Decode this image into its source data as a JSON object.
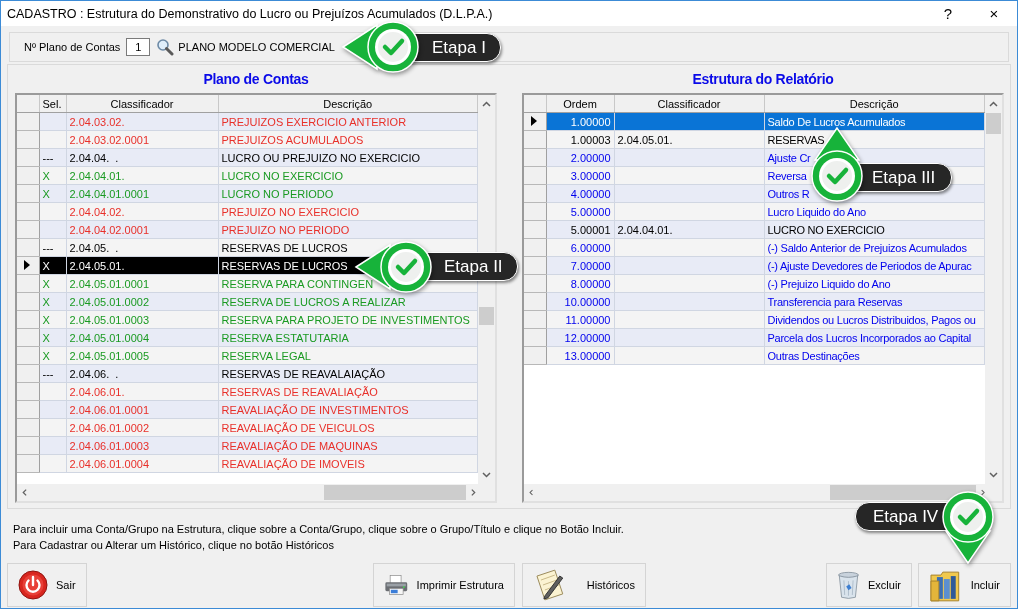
{
  "window": {
    "title": "CADASTRO : Estrutura do Demonstrativo do Lucro ou Prejuízos Acumulados (D.L.P.A.)",
    "controls": [
      "?",
      "×"
    ]
  },
  "plan": {
    "label": "Nº Plano de Contas",
    "number": "1",
    "name": "PLANO MODELO COMERCIAL"
  },
  "left_panel": {
    "title": "Plano de Contas",
    "columns": [
      "Sel.",
      "Classificador",
      "Descrição"
    ],
    "rows": [
      {
        "classificador": "2.04.03.02.",
        "descricao": "PREJUIZOS EXERCICIO ANTERIOR",
        "color": "#e8302a",
        "selected": false
      },
      {
        "classificador": "2.04.03.02.0001",
        "descricao": "PREJUIZOS ACUMULADOS",
        "color": "#e8302a",
        "selected": false
      },
      {
        "sel": "---",
        "classificador": "2.04.04.  .",
        "descricao": "LUCRO OU PREJUIZO NO EXERCICIO",
        "color": "#000000",
        "selected": false
      },
      {
        "sel": "X",
        "classificador": "2.04.04.01.",
        "descricao": "LUCRO NO EXERCICIO",
        "color": "#1a9a22",
        "selected": false
      },
      {
        "sel": "X",
        "classificador": "2.04.04.01.0001",
        "descricao": "LUCRO NO PERIODO",
        "color": "#1a9a22",
        "selected": false
      },
      {
        "classificador": "2.04.04.02.",
        "descricao": "PREJUIZO NO EXERCICIO",
        "color": "#e8302a",
        "selected": false
      },
      {
        "classificador": "2.04.04.02.0001",
        "descricao": "PREJUIZO NO PERIODO",
        "color": "#e8302a",
        "selected": false
      },
      {
        "sel": "---",
        "classificador": "2.04.05.  .",
        "descricao": "RESERVAS DE LUCROS",
        "color": "#000000",
        "selected": false
      },
      {
        "sel": "X",
        "classificador": "2.04.05.01.",
        "descricao": "RESERVAS DE LUCROS",
        "selected": true
      },
      {
        "sel": "X",
        "classificador": "2.04.05.01.0001",
        "descricao": "RESERVA PARA CONTINGEN",
        "color": "#1a9a22",
        "selected": false
      },
      {
        "sel": "X",
        "classificador": "2.04.05.01.0002",
        "descricao": "RESERVA DE LUCROS A REALIZAR",
        "color": "#1a9a22",
        "selected": false
      },
      {
        "sel": "X",
        "classificador": "2.04.05.01.0003",
        "descricao": "RESERVA PARA PROJETO DE INVESTIMENTOS",
        "color": "#1a9a22",
        "selected": false
      },
      {
        "sel": "X",
        "classificador": "2.04.05.01.0004",
        "descricao": "RESERVA ESTATUTARIA",
        "color": "#1a9a22",
        "selected": false
      },
      {
        "sel": "X",
        "classificador": "2.04.05.01.0005",
        "descricao": "RESERVA LEGAL",
        "color": "#1a9a22",
        "selected": false
      },
      {
        "sel": "---",
        "classificador": "2.04.06.  .",
        "descricao": "RESERVAS DE REAVALAIAÇÃO",
        "color": "#000000",
        "selected": false
      },
      {
        "classificador": "2.04.06.01.",
        "descricao": "RESERVAS DE REAVALIAÇÃO",
        "color": "#e8302a",
        "selected": false
      },
      {
        "classificador": "2.04.06.01.0001",
        "descricao": "REAVALIAÇÃO DE INVESTIMENTOS",
        "color": "#e8302a",
        "selected": false
      },
      {
        "classificador": "2.04.06.01.0002",
        "descricao": "REAVALIAÇÃO DE VEICULOS",
        "color": "#e8302a",
        "selected": false
      },
      {
        "classificador": "2.04.06.01.0003",
        "descricao": "REAVALIAÇÃO DE MAQUINAS",
        "color": "#e8302a",
        "selected": false
      },
      {
        "classificador": "2.04.06.01.0004",
        "descricao": "REAVALIAÇÃO DE IMOVEIS",
        "color": "#e8302a",
        "selected": false
      }
    ]
  },
  "right_panel": {
    "title": "Estrutura do Relatório",
    "columns": [
      "Ordem",
      "Classificador",
      "Descrição"
    ],
    "rows": [
      {
        "ordem": "1.00000",
        "descricao": "Saldo De Lucros Acumulados",
        "selected": true
      },
      {
        "ordem": "1.00003",
        "classificador": "2.04.05.01.",
        "descricao": "RESERVAS",
        "color": "#000000",
        "selected": false
      },
      {
        "ordem": "2.00000",
        "descricao": "Ajuste Cr",
        "color": "#0000ee",
        "selected": false
      },
      {
        "ordem": "3.00000",
        "descricao": "Reversa",
        "color": "#0000ee",
        "selected": false
      },
      {
        "ordem": "4.00000",
        "descricao": "Outros R",
        "color": "#0000ee",
        "selected": false
      },
      {
        "ordem": "5.00000",
        "descricao": "Lucro Liquido do Ano",
        "color": "#0000ee",
        "selected": false
      },
      {
        "ordem": "5.00001",
        "classificador": "2.04.04.01.",
        "descricao": "LUCRO NO EXERCICIO",
        "color": "#000000",
        "selected": false
      },
      {
        "ordem": "6.00000",
        "descricao": "(-) Saldo Anterior de Prejuizos Acumulados",
        "color": "#0000ee",
        "selected": false
      },
      {
        "ordem": "7.00000",
        "descricao": "(-) Ajuste Devedores de Periodos de Apurac",
        "color": "#0000ee",
        "selected": false
      },
      {
        "ordem": "8.00000",
        "descricao": "(-) Prejuizo Liquido do Ano",
        "color": "#0000ee",
        "selected": false
      },
      {
        "ordem": "10.00000",
        "descricao": "Transferencia para Reservas",
        "color": "#0000ee",
        "selected": false
      },
      {
        "ordem": "11.00000",
        "descricao": "Dividendos ou Lucros Distribuidos, Pagos ou",
        "color": "#0000ee",
        "selected": false
      },
      {
        "ordem": "12.00000",
        "descricao": "Parcela dos Lucros Incorporados ao Capital",
        "color": "#0000ee",
        "selected": false
      },
      {
        "ordem": "13.00000",
        "descricao": "Outras Destinações",
        "color": "#0000ee",
        "selected": false
      }
    ]
  },
  "help_lines": [
    "Para incluir uma Conta/Grupo na Estrutura, clique sobre a Conta/Grupo, clique sobre o Grupo/Título e clique no Botão Incluir.",
    "Para Cadastrar ou Alterar um Histórico, clique no botão Históricos"
  ],
  "footer_buttons": {
    "left": [
      {
        "label": "Sair",
        "kind": "power"
      }
    ],
    "center": [
      {
        "label": "Imprimir Estrutura",
        "kind": "printer"
      },
      {
        "label": "Históricos",
        "kind": "notepad"
      }
    ],
    "right": [
      {
        "label": "Excluir",
        "kind": "trash"
      },
      {
        "label": "Incluir",
        "kind": "folder"
      }
    ]
  },
  "callouts": [
    {
      "label": "Etapa I",
      "kind": "left"
    },
    {
      "label": "Etapa II",
      "kind": "left"
    },
    {
      "label": "Etapa III",
      "kind": "up"
    },
    {
      "label": "Etapa IV",
      "kind": "down"
    }
  ]
}
